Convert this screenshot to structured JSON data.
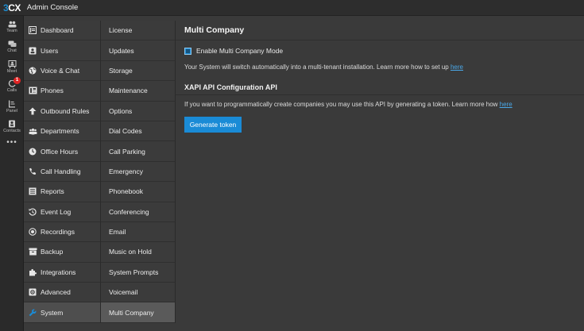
{
  "topbar": {
    "logo_num": "3",
    "logo_text": "CX",
    "title": "Admin Console"
  },
  "rail": {
    "items": [
      {
        "label": "Team",
        "icon": "team-icon"
      },
      {
        "label": "Chat",
        "icon": "chat-icon"
      },
      {
        "label": "Meet",
        "icon": "meet-icon"
      },
      {
        "label": "Calls",
        "icon": "calls-icon",
        "badge": "1"
      },
      {
        "label": "Panel",
        "icon": "panel-icon"
      },
      {
        "label": "Contacts",
        "icon": "contacts-icon"
      }
    ],
    "more": "•••"
  },
  "nav_left": [
    {
      "label": "Dashboard",
      "icon": "dashboard-icon"
    },
    {
      "label": "Users",
      "icon": "user-icon"
    },
    {
      "label": "Voice & Chat",
      "icon": "globe-icon"
    },
    {
      "label": "Phones",
      "icon": "phone-device-icon"
    },
    {
      "label": "Outbound Rules",
      "icon": "arrow-up-icon"
    },
    {
      "label": "Departments",
      "icon": "group-icon"
    },
    {
      "label": "Office Hours",
      "icon": "clock-icon"
    },
    {
      "label": "Call Handling",
      "icon": "handset-icon"
    },
    {
      "label": "Reports",
      "icon": "reports-icon"
    },
    {
      "label": "Event Log",
      "icon": "history-icon"
    },
    {
      "label": "Recordings",
      "icon": "record-icon"
    },
    {
      "label": "Backup",
      "icon": "archive-icon"
    },
    {
      "label": "Integrations",
      "icon": "puzzle-icon"
    },
    {
      "label": "Advanced",
      "icon": "gear-icon"
    },
    {
      "label": "System",
      "icon": "wrench-icon",
      "active": true
    }
  ],
  "nav_right": [
    {
      "label": "License"
    },
    {
      "label": "Updates"
    },
    {
      "label": "Storage"
    },
    {
      "label": "Maintenance"
    },
    {
      "label": "Options"
    },
    {
      "label": "Dial Codes"
    },
    {
      "label": "Call Parking"
    },
    {
      "label": "Emergency"
    },
    {
      "label": "Phonebook"
    },
    {
      "label": "Conferencing"
    },
    {
      "label": "Email"
    },
    {
      "label": "Music on Hold"
    },
    {
      "label": "System Prompts"
    },
    {
      "label": "Voicemail"
    },
    {
      "label": "Multi Company",
      "active": true
    }
  ],
  "main": {
    "title": "Multi Company",
    "enable_label": "Enable Multi Company Mode",
    "enable_checked": true,
    "switch_text": "Your System will switch automatically into a multi-tenant installation. Learn more how to set up ",
    "switch_link": "here",
    "api_title": "XAPI API Configuration API",
    "api_text": "If you want to programmatically create companies you may use this API by generating a token. Learn more how ",
    "api_link": "here",
    "generate_button": "Generate token"
  },
  "colors": {
    "accent": "#1a8bd6",
    "link": "#4aa8e8",
    "badge": "#e02424"
  }
}
